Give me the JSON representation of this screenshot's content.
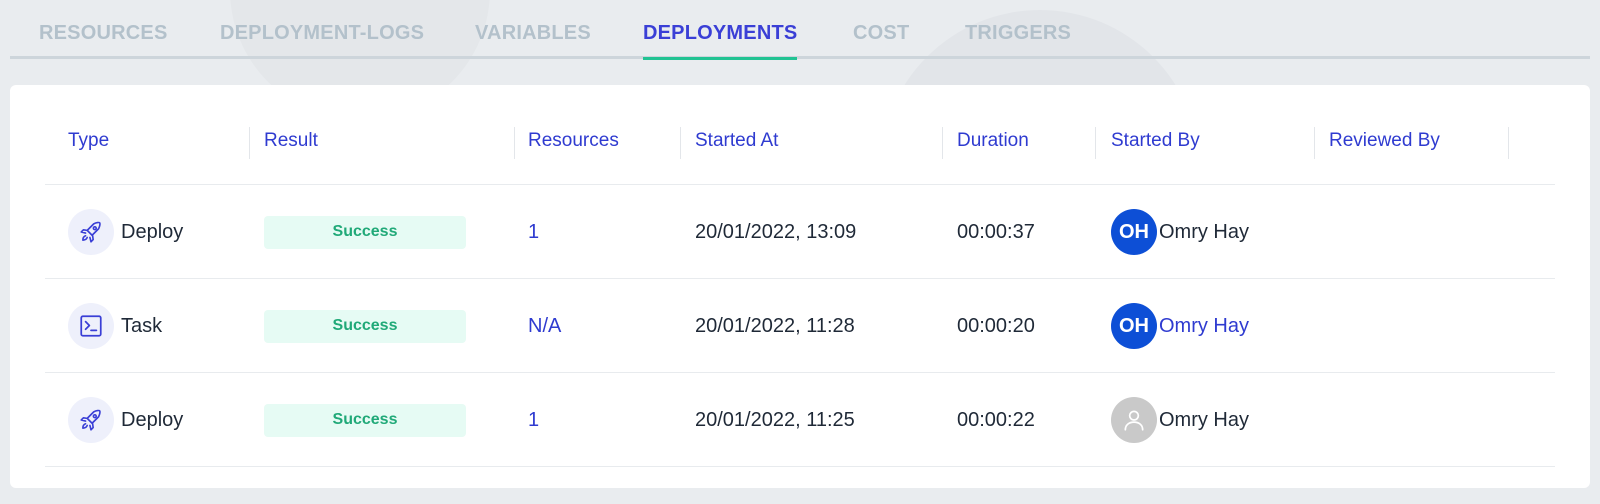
{
  "tabs": [
    {
      "label": "RESOURCES",
      "active": false
    },
    {
      "label": "DEPLOYMENT-LOGS",
      "active": false
    },
    {
      "label": "VARIABLES",
      "active": false
    },
    {
      "label": "DEPLOYMENTS",
      "active": true
    },
    {
      "label": "COST",
      "active": false
    },
    {
      "label": "TRIGGERS",
      "active": false
    }
  ],
  "table": {
    "columns": [
      "Type",
      "Result",
      "Resources",
      "Started At",
      "Duration",
      "Started By",
      "Reviewed By"
    ],
    "rows": [
      {
        "type": "Deploy",
        "type_icon": "rocket-icon",
        "result": "Success",
        "resources": "1",
        "started_at": "20/01/2022, 13:09",
        "duration": "00:00:37",
        "started_by": {
          "initials": "OH",
          "name": "Omry Hay",
          "avatar": "initials",
          "name_is_link": false
        },
        "reviewed_by": ""
      },
      {
        "type": "Task",
        "type_icon": "terminal-icon",
        "result": "Success",
        "resources": "N/A",
        "started_at": "20/01/2022, 11:28",
        "duration": "00:00:20",
        "started_by": {
          "initials": "OH",
          "name": "Omry Hay",
          "avatar": "initials",
          "name_is_link": true
        },
        "reviewed_by": ""
      },
      {
        "type": "Deploy",
        "type_icon": "rocket-icon",
        "result": "Success",
        "resources": "1",
        "started_at": "20/01/2022, 11:25",
        "duration": "00:00:22",
        "started_by": {
          "initials": "",
          "name": "Omry Hay",
          "avatar": "placeholder",
          "name_is_link": false
        },
        "reviewed_by": ""
      }
    ]
  },
  "colors": {
    "accent": "#2f3bd0",
    "tab_active": "#3a3fd6",
    "tab_indicator": "#21c393",
    "tab_inactive": "#b3c1cb",
    "success_bg": "#e6fbf4",
    "success_text": "#20a978",
    "avatar_blue": "#0d4fd6",
    "avatar_placeholder": "#c9c9c9"
  }
}
